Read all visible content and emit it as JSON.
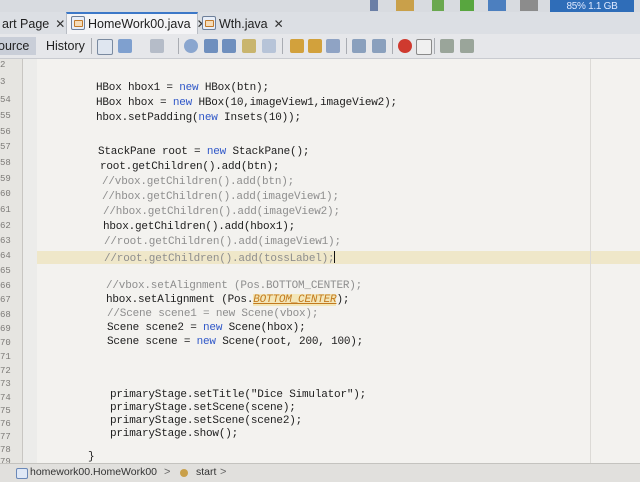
{
  "status": {
    "memory_label": "85% 1.1 GB"
  },
  "tabs": [
    {
      "label": "art Page",
      "close": "✕"
    },
    {
      "label": "HomeWork00.java",
      "close": "✕"
    },
    {
      "label": "Wth.java",
      "close": "✕"
    }
  ],
  "editor_tabs": {
    "source": "ource",
    "history": "History"
  },
  "line_numbers": [
    "2",
    "3",
    "54",
    "55",
    "56",
    "57",
    "58",
    "59",
    "60",
    "61",
    "62",
    "63",
    "64",
    "65",
    "66",
    "67",
    "68",
    "69",
    "70",
    "71",
    "72",
    "73",
    "74",
    "75",
    "76",
    "77",
    "78",
    "79"
  ],
  "code": {
    "l53": "HBox hbox1 = new HBox(btn);",
    "l54": "HBox hbox = new HBox(10,imageView1,imageView2);",
    "l55": "hbox.setPadding(new Insets(10));",
    "l57": "StackPane root = new StackPane();",
    "l58": "root.getChildren().add(btn);",
    "l59": "//vbox.getChildren().add(btn);",
    "l60": "//hbox.getChildren().add(imageView1);",
    "l61": "//hbox.getChildren().add(imageView2);",
    "l62": "hbox.getChildren().add(hbox1);",
    "l63": "//root.getChildren().add(imageView1);",
    "l64": "//root.getChildren().add(tossLabel);",
    "l66": "//vbox.setAlignment (Pos.BOTTOM_CENTER);",
    "l67_a": "hbox.setAlignment (Pos.",
    "l67_b": "BOTTOM_CENTER",
    "l67_c": ");",
    "l68": "//Scene scene1 = new Scene(vbox);",
    "l69": "Scene scene2 = new Scene(hbox);",
    "l70": "Scene scene = new Scene(root, 200, 100);",
    "l74": "primaryStage.setTitle(\"Dice Simulator\");",
    "l75": "primaryStage.setScene(scene);",
    "l76": "primaryStage.setScene(scene2);",
    "l77": "primaryStage.show();",
    "l79": "}"
  },
  "breadcrumb": {
    "class": "homework00.HomeWork00",
    "method": "start",
    "sep": ">"
  }
}
